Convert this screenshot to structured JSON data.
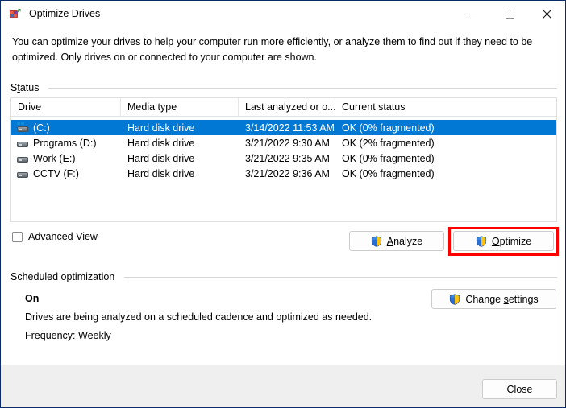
{
  "window": {
    "title": "Optimize Drives",
    "icon": "optimize-drives-icon",
    "controls": {
      "minimize": "Minimize",
      "maximize": "Maximize",
      "close": "Close"
    }
  },
  "description": "You can optimize your drives to help your computer run more efficiently, or analyze them to find out if they need to be optimized. Only drives on or connected to your computer are shown.",
  "status_group": {
    "label_prefix": "S",
    "label_accesskey": "t",
    "label_suffix": "atus",
    "label": "Status"
  },
  "table": {
    "columns": [
      {
        "label": "Drive"
      },
      {
        "label": "Media type"
      },
      {
        "label": "Last analyzed or o..."
      },
      {
        "label": "Current status"
      }
    ],
    "rows": [
      {
        "drive": "(C:)",
        "media_type": "Hard disk drive",
        "last_analyzed": "3/14/2022 11:53 AM",
        "current_status": "OK (0% fragmented)",
        "selected": true,
        "icon": "system-hard-drive-icon"
      },
      {
        "drive": "Programs (D:)",
        "media_type": "Hard disk drive",
        "last_analyzed": "3/21/2022 9:30 AM",
        "current_status": "OK (2% fragmented)",
        "selected": false,
        "icon": "hard-drive-icon"
      },
      {
        "drive": "Work (E:)",
        "media_type": "Hard disk drive",
        "last_analyzed": "3/21/2022 9:35 AM",
        "current_status": "OK (0% fragmented)",
        "selected": false,
        "icon": "hard-drive-icon"
      },
      {
        "drive": "CCTV (F:)",
        "media_type": "Hard disk drive",
        "last_analyzed": "3/21/2022 9:36 AM",
        "current_status": "OK (0% fragmented)",
        "selected": false,
        "icon": "hard-drive-icon"
      }
    ]
  },
  "advanced_view": {
    "label_pre": "A",
    "label_key": "d",
    "label_post": "vanced View",
    "checked": false
  },
  "buttons": {
    "analyze": {
      "pre": "",
      "key": "A",
      "post": "nalyze",
      "shield": true
    },
    "optimize": {
      "pre": "",
      "key": "O",
      "post": "ptimize",
      "shield": true
    },
    "change_settings": {
      "pre": "Change ",
      "key": "s",
      "post": "ettings",
      "shield": true
    },
    "close": {
      "pre": "",
      "key": "C",
      "post": "lose",
      "shield": false
    }
  },
  "scheduled_group": {
    "label": "Scheduled optimization",
    "state": "On",
    "description": "Drives are being analyzed on a scheduled cadence and optimized as needed.",
    "frequency": "Frequency: Weekly"
  },
  "highlight": {
    "target": "optimize-button",
    "color": "#ff0000"
  },
  "colors": {
    "selection": "#0078d4",
    "window_border": "#0d2a6b",
    "footer": "#efefef",
    "shield_blue": "#2a6ed1",
    "shield_gold": "#ffc20e"
  }
}
